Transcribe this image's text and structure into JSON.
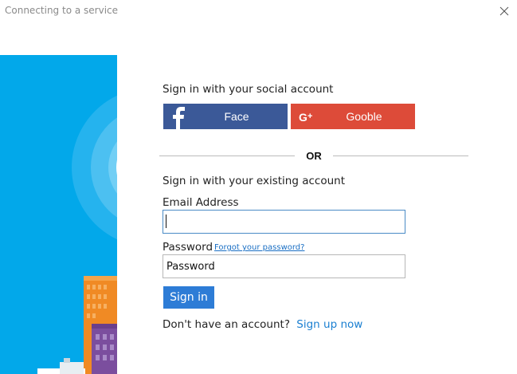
{
  "window": {
    "title": "Connecting to a service"
  },
  "social": {
    "heading": "Sign in with your social account",
    "facebook_label": "Face",
    "google_label": "Gooble",
    "facebook_color": "#3b5998",
    "google_color": "#dd4b39"
  },
  "divider": {
    "label": "OR"
  },
  "account": {
    "heading": "Sign in with your existing account",
    "email_label": "Email Address",
    "email_value": "",
    "password_label": "Password",
    "forgot_password": "Forgot your password?",
    "password_placeholder": "Password",
    "signin_label": "Sign in",
    "no_account_text": "Don't have an account?",
    "signup_label": "Sign up now"
  },
  "colors": {
    "hero_background": "#02a8ea",
    "accent": "#2d7cd6",
    "link": "#1a7fd1"
  },
  "icons": {
    "close": "close-icon",
    "facebook": "facebook-icon",
    "google": "google-plus-icon"
  }
}
